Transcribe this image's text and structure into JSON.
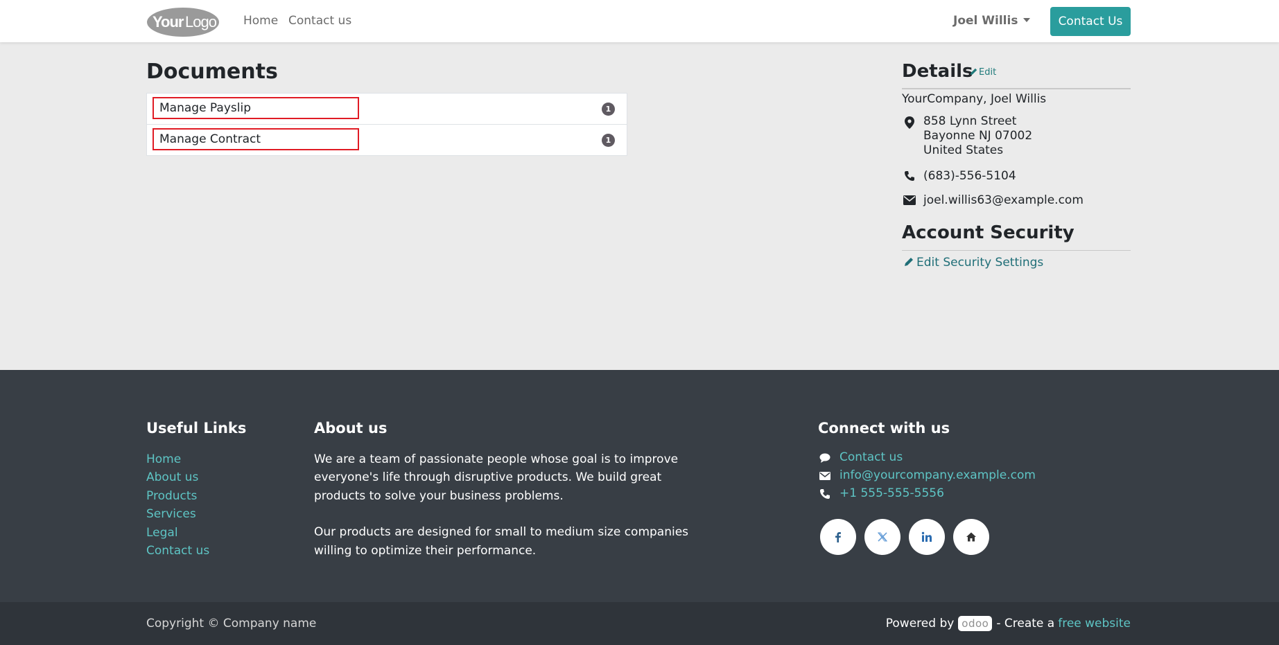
{
  "header": {
    "logo_text": "YourLogo",
    "nav": [
      {
        "label": "Home"
      },
      {
        "label": "Contact us"
      }
    ],
    "user_name": "Joel Willis",
    "cta_label": "Contact Us"
  },
  "documents": {
    "title": "Documents",
    "items": [
      {
        "label": "Manage Payslip",
        "count": "1"
      },
      {
        "label": "Manage Contract",
        "count": "1"
      }
    ]
  },
  "details": {
    "title": "Details",
    "edit_label": "Edit",
    "company_name": "YourCompany, Joel Willis",
    "address_lines": [
      "858 Lynn Street",
      "Bayonne NJ 07002",
      "United States"
    ],
    "phone": "(683)-556-5104",
    "email": "joel.willis63@example.com"
  },
  "security": {
    "title": "Account Security",
    "link_label": "Edit Security Settings"
  },
  "footer": {
    "useful_links_title": "Useful Links",
    "useful_links": [
      "Home",
      "About us",
      "Products",
      "Services",
      "Legal",
      "Contact us"
    ],
    "about_title": "About us",
    "about_p1": "We are a team of passionate people whose goal is to improve everyone's life through disruptive products. We build great products to solve your business problems.",
    "about_p2": "Our products are designed for small to medium size companies willing to optimize their performance.",
    "connect_title": "Connect with us",
    "contact_label": "Contact us",
    "contact_email": "info@yourcompany.example.com",
    "contact_phone": "+1 555-555-5556",
    "social_icons": [
      "facebook-icon",
      "x-twitter-icon",
      "linkedin-icon",
      "home-icon"
    ]
  },
  "bottom": {
    "copyright": "Copyright © Company name",
    "powered_by": "Powered by",
    "odoo_logo": "odoo",
    "create_a": "- Create a",
    "free_website": "free website"
  },
  "colors": {
    "accent": "#2a9d9d",
    "link_teal": "#5ec5c5",
    "highlight_red": "#e01b24",
    "footer_bg": "#383e45",
    "bottom_bg": "#2f343a",
    "page_bg": "#ebebeb"
  }
}
